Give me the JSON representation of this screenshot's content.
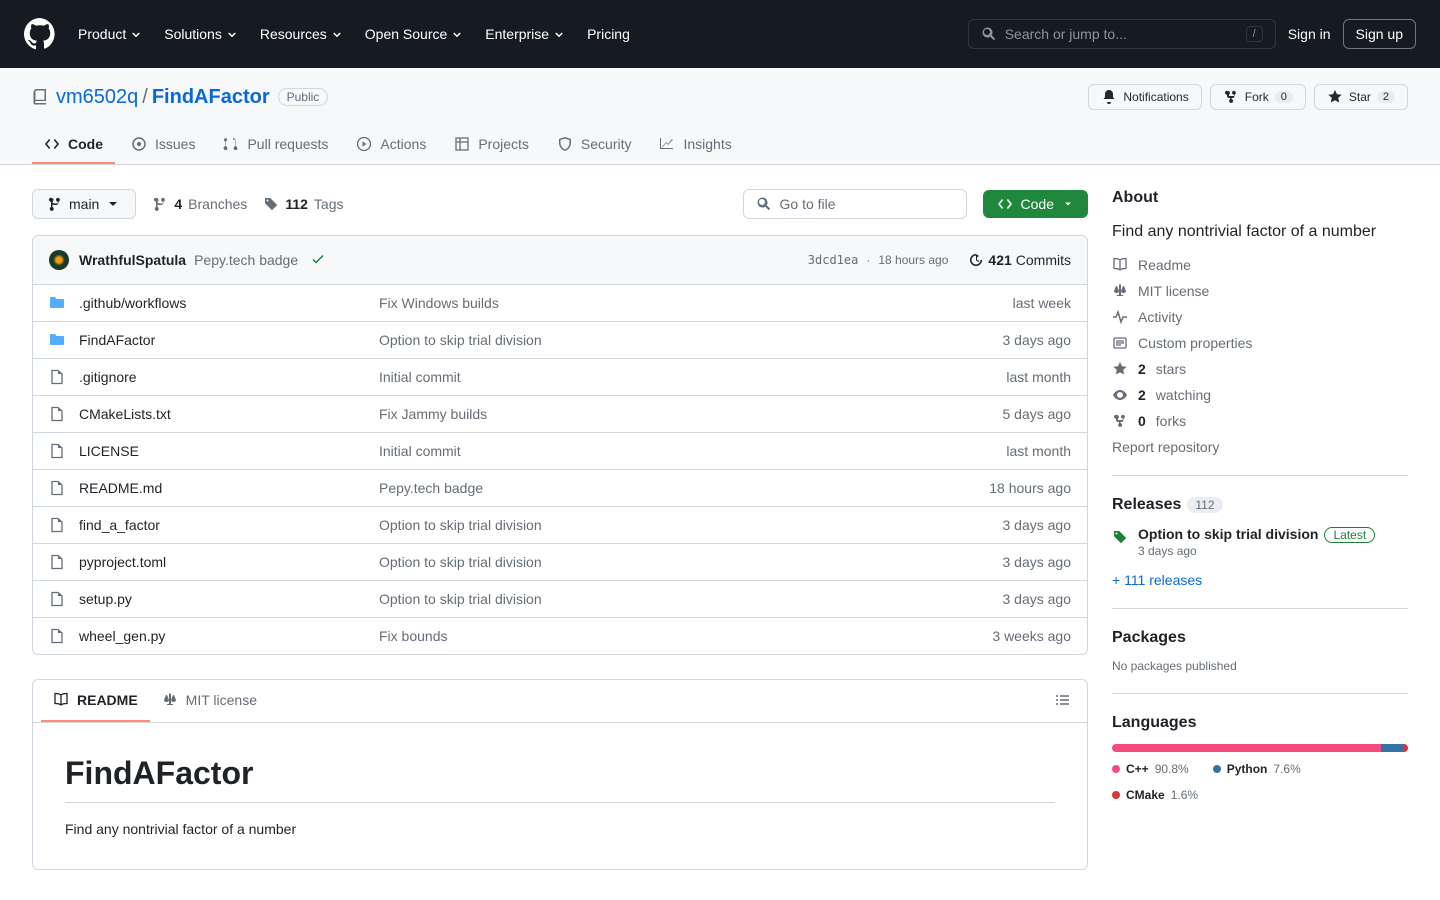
{
  "header": {
    "nav": [
      "Product",
      "Solutions",
      "Resources",
      "Open Source",
      "Enterprise",
      "Pricing"
    ],
    "searchPlaceholder": "Search or jump to...",
    "signin": "Sign in",
    "signup": "Sign up"
  },
  "repo": {
    "owner": "vm6502q",
    "name": "FindAFactor",
    "visibility": "Public",
    "actions": {
      "notifications": "Notifications",
      "fork": "Fork",
      "forkCount": "0",
      "star": "Star",
      "starCount": "2"
    }
  },
  "tabs": [
    "Code",
    "Issues",
    "Pull requests",
    "Actions",
    "Projects",
    "Security",
    "Insights"
  ],
  "fileNav": {
    "branch": "main",
    "branchesCount": "4",
    "branchesLabel": "Branches",
    "tagsCount": "112",
    "tagsLabel": "Tags",
    "goToFile": "Go to file",
    "code": "Code"
  },
  "latestCommit": {
    "author": "WrathfulSpatula",
    "message": "Pepy.tech badge",
    "sha": "3dcd1ea",
    "when": "18 hours ago",
    "commitsCount": "421",
    "commitsLabel": "Commits"
  },
  "files": [
    {
      "type": "dir",
      "name": ".github/workflows",
      "msg": "Fix Windows builds",
      "when": "last week"
    },
    {
      "type": "dir",
      "name": "FindAFactor",
      "msg": "Option to skip trial division",
      "when": "3 days ago"
    },
    {
      "type": "file",
      "name": ".gitignore",
      "msg": "Initial commit",
      "when": "last month"
    },
    {
      "type": "file",
      "name": "CMakeLists.txt",
      "msg": "Fix Jammy builds",
      "when": "5 days ago"
    },
    {
      "type": "file",
      "name": "LICENSE",
      "msg": "Initial commit",
      "when": "last month"
    },
    {
      "type": "file",
      "name": "README.md",
      "msg": "Pepy.tech badge",
      "when": "18 hours ago"
    },
    {
      "type": "file",
      "name": "find_a_factor",
      "msg": "Option to skip trial division",
      "when": "3 days ago"
    },
    {
      "type": "file",
      "name": "pyproject.toml",
      "msg": "Option to skip trial division",
      "when": "3 days ago"
    },
    {
      "type": "file",
      "name": "setup.py",
      "msg": "Option to skip trial division",
      "when": "3 days ago"
    },
    {
      "type": "file",
      "name": "wheel_gen.py",
      "msg": "Fix bounds",
      "when": "3 weeks ago"
    }
  ],
  "readme": {
    "tabs": [
      "README",
      "MIT license"
    ],
    "title": "FindAFactor",
    "tagline": "Find any nontrivial factor of a number"
  },
  "about": {
    "title": "About",
    "desc": "Find any nontrivial factor of a number",
    "links": {
      "readme": "Readme",
      "license": "MIT license",
      "activity": "Activity",
      "custom": "Custom properties",
      "starsN": "2",
      "starsL": "stars",
      "watchN": "2",
      "watchL": "watching",
      "forksN": "0",
      "forksL": "forks",
      "report": "Report repository"
    }
  },
  "releases": {
    "title": "Releases",
    "count": "112",
    "latest": "Option to skip trial division",
    "latestBadge": "Latest",
    "when": "3 days ago",
    "more": "+ 111 releases"
  },
  "packages": {
    "title": "Packages",
    "none": "No packages published"
  },
  "languages": {
    "title": "Languages",
    "bars": [
      {
        "color": "#f34b7d",
        "pct": 90.8
      },
      {
        "color": "#3572A5",
        "pct": 7.6
      },
      {
        "color": "#DA3434",
        "pct": 1.6
      }
    ],
    "list": [
      {
        "name": "C++",
        "pct": "90.8%",
        "color": "#f34b7d"
      },
      {
        "name": "Python",
        "pct": "7.6%",
        "color": "#3572A5"
      },
      {
        "name": "CMake",
        "pct": "1.6%",
        "color": "#DA3434"
      }
    ]
  }
}
